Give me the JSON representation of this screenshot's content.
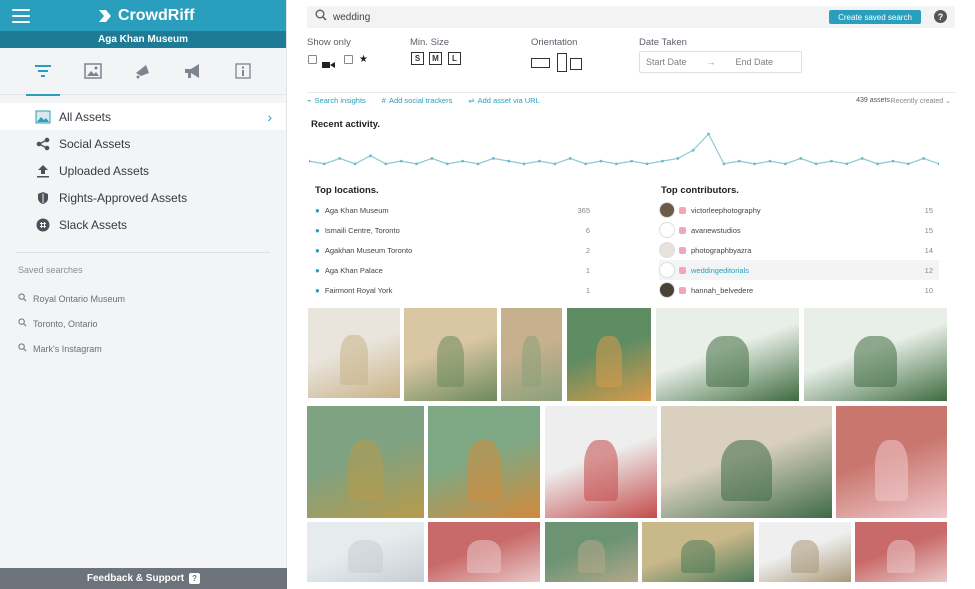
{
  "app": {
    "name": "CrowdRiff",
    "org": "Aga Khan Museum"
  },
  "sidebar": {
    "tabs": [
      {
        "name": "filter-tab-icon",
        "active": true
      },
      {
        "name": "gallery-tab-icon",
        "active": false
      },
      {
        "name": "megaphone-dot-tab-icon",
        "active": false
      },
      {
        "name": "megaphone-tab-icon",
        "active": false
      },
      {
        "name": "info-tab-icon",
        "active": false
      }
    ],
    "nav": [
      {
        "label": "All Assets",
        "icon": "image-icon",
        "active": true
      },
      {
        "label": "Social Assets",
        "icon": "share-icon",
        "active": false
      },
      {
        "label": "Uploaded Assets",
        "icon": "upload-icon",
        "active": false
      },
      {
        "label": "Rights-Approved Assets",
        "icon": "shield-icon",
        "active": false
      },
      {
        "label": "Slack Assets",
        "icon": "slack-icon",
        "active": false
      }
    ],
    "saved_searches_label": "Saved searches",
    "saved_searches": [
      "Royal Ontario Museum",
      "Toronto, Ontario",
      "Mark's Instagram"
    ],
    "feedback_label": "Feedback & Support"
  },
  "search": {
    "value": "wedding",
    "create_saved_label": "Create saved search",
    "help_label": "?"
  },
  "filters": {
    "show_only_label": "Show only",
    "min_size_label": "Min. Size",
    "sizes": [
      "S",
      "M",
      "L"
    ],
    "orientation_label": "Orientation",
    "date_taken_label": "Date Taken",
    "start_date": "Start Date",
    "end_date": "End Date"
  },
  "subtools": {
    "items": [
      "Search insights",
      "Add social trackers",
      "Add asset via URL"
    ],
    "asset_count": "439 assets",
    "sort": "Recently created"
  },
  "recent": {
    "title": "Recent activity.",
    "series": [
      4,
      3,
      5,
      3,
      6,
      3,
      4,
      3,
      5,
      3,
      4,
      3,
      5,
      4,
      3,
      4,
      3,
      5,
      3,
      4,
      3,
      4,
      3,
      4,
      5,
      8,
      14,
      3,
      4,
      3,
      4,
      3,
      5,
      3,
      4,
      3,
      5,
      3,
      4,
      3,
      5,
      3
    ]
  },
  "top_locations": {
    "title": "Top locations.",
    "rows": [
      {
        "name": "Aga Khan Museum",
        "count": "365"
      },
      {
        "name": "Ismaili Centre, Toronto",
        "count": "6"
      },
      {
        "name": "Agakhan Museum Toronto",
        "count": "2"
      },
      {
        "name": "Aga Khan Palace",
        "count": "1"
      },
      {
        "name": "Fairmont Royal York",
        "count": "1"
      }
    ]
  },
  "top_contributors": {
    "title": "Top contributors.",
    "rows": [
      {
        "name": "victorleephotography",
        "count": "15",
        "avatar": "#6b5a48"
      },
      {
        "name": "avanewstudios",
        "count": "15",
        "avatar": "#ffffff"
      },
      {
        "name": "photographbyazra",
        "count": "14",
        "avatar": "#e8e2dc"
      },
      {
        "name": "weddingeditorials",
        "count": "12",
        "avatar": "#ffffff"
      },
      {
        "name": "hannah_belvedere",
        "count": "10",
        "avatar": "#4a4036"
      }
    ]
  },
  "colors": {
    "accent": "#2a9fbd",
    "accent_dark": "#1d7b95",
    "sidebar_bg": "#f3f4f6"
  }
}
